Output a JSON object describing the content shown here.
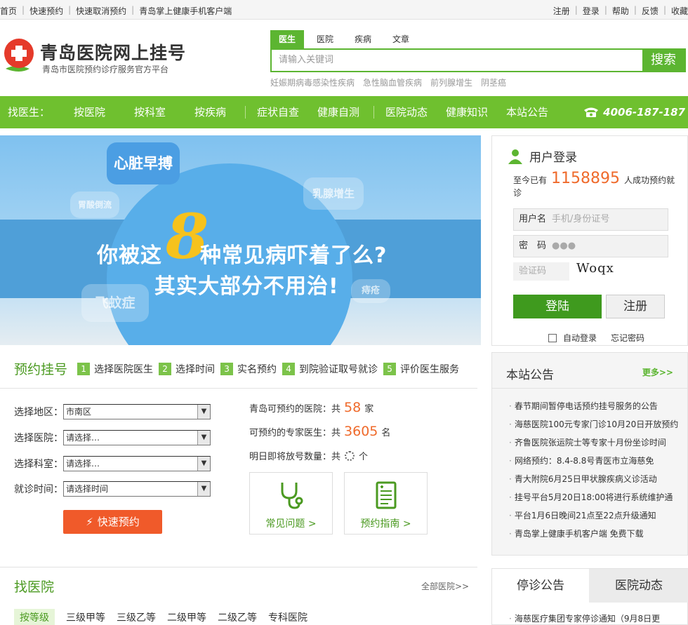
{
  "topbar": {
    "left": [
      "首页",
      "快速预约",
      "快速取消预约",
      "青岛掌上健康手机客户端"
    ],
    "right": [
      "注册",
      "登录",
      "帮助",
      "反馈",
      "收藏"
    ]
  },
  "logo": {
    "title": "青岛医院网上挂号",
    "subtitle": "青岛市医院预约诊疗服务官方平台"
  },
  "search": {
    "tabs": [
      "医生",
      "医院",
      "疾病",
      "文章"
    ],
    "placeholder": "请输入关键词",
    "button": "搜索",
    "hot": [
      "妊娠期病毒感染性疾病",
      "急性脑血管疾病",
      "前列腺增生",
      "阴茎癌"
    ]
  },
  "nav": {
    "find_label": "找医生：",
    "items": [
      "按医院",
      "按科室",
      "按疾病",
      "症状自查",
      "健康自测",
      "医院动态",
      "健康知识",
      "本站公告"
    ],
    "phone": "4006-187-187"
  },
  "banner": {
    "line1": "你被这",
    "num": "8",
    "line1b": "种常见病吓着了么?",
    "line2": "其实大部分不用治!",
    "bubbles": [
      "心脏早搏",
      "乳腺增生",
      "飞蚊症",
      "胃酸倒流",
      "痔疮"
    ]
  },
  "login": {
    "title": "用户登录",
    "count_prefix": "至今已有",
    "count": "1158895",
    "count_suffix": "人成功预约就诊",
    "username_label": "用户名",
    "username_placeholder": "手机/身份证号",
    "password_label": "密　码",
    "password_value": "●●●",
    "captcha_placeholder": "验证码",
    "captcha_code": "Woqx",
    "login_btn": "登陆",
    "register_btn": "注册",
    "auto_login": "自动登录",
    "forgot": "忘记密码"
  },
  "steps": {
    "title": "预约挂号",
    "items": [
      {
        "num": "1",
        "label": "选择医院医生"
      },
      {
        "num": "2",
        "label": "选择时间"
      },
      {
        "num": "3",
        "label": "实名预约"
      },
      {
        "num": "4",
        "label": "到院验证取号就诊"
      },
      {
        "num": "5",
        "label": "评价医生服务"
      }
    ]
  },
  "form": {
    "area_label": "选择地区：",
    "area_value": "市南区",
    "hospital_label": "选择医院：",
    "hospital_value": "请选择…",
    "dept_label": "选择科室：",
    "dept_value": "请选择…",
    "time_label": "就诊时间：",
    "time_value": "请选择时间",
    "quick_btn": "快速预约"
  },
  "stats": {
    "hospitals_prefix": "青岛可预约的医院：共",
    "hospitals": "58",
    "hospitals_unit": "家",
    "experts_prefix": "可预约的专家医生：共",
    "experts": "3605",
    "experts_unit": "名",
    "tomorrow_prefix": "明日即将放号数量：共",
    "tomorrow_unit": "个",
    "faq": "常见问题 >",
    "guide": "预约指南 >"
  },
  "find_hospital": {
    "title": "找医院",
    "all": "全部医院>>",
    "levels": [
      "按等级",
      "三级甲等",
      "三级乙等",
      "二级甲等",
      "二级乙等",
      "专科医院"
    ]
  },
  "notice": {
    "title": "本站公告",
    "more": "更多>>",
    "items": [
      "春节期间暂停电话预约挂号服务的公告",
      "海慈医院100元专家门诊10月20日开放预约",
      "齐鲁医院张运院士等专家十月份坐诊时间",
      "网络预约：8.4-8.8号青医市立海慈免",
      "青大附院6月25日甲状腺疾病义诊活动",
      "挂号平台5月20日18:00将进行系统维护通",
      "平台1月6日晚间21点至22点升级通知",
      "青岛掌上健康手机客户端 免费下载"
    ]
  },
  "tabs2": {
    "tab1": "停诊公告",
    "tab2": "医院动态",
    "first_item": "海慈医疗集团专家停诊通知（9月8日更"
  },
  "colors": {
    "green": "#6fc02f",
    "dark_green": "#3f9a1e",
    "orange": "#ef6a2b"
  }
}
